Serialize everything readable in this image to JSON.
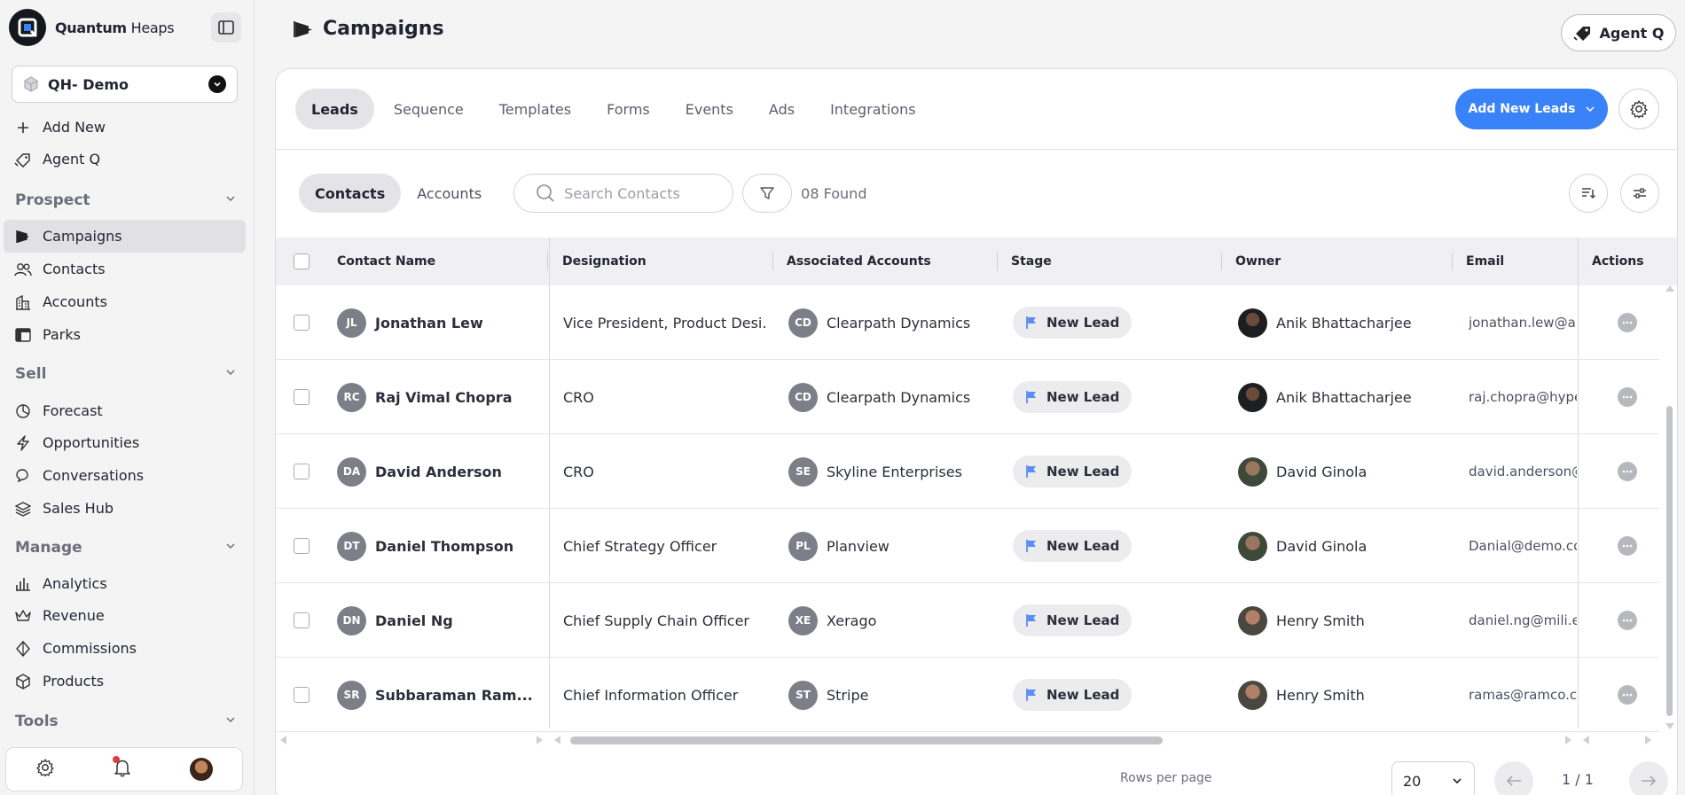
{
  "brand": {
    "name_bold": "Quantum",
    "name_light": " Heaps"
  },
  "workspace": {
    "name": "QH- Demo"
  },
  "sidebar": {
    "top_items": [
      {
        "label": "Add New"
      },
      {
        "label": "Agent Q"
      }
    ],
    "sections": [
      {
        "title": "Prospect",
        "items": [
          "Campaigns",
          "Contacts",
          "Accounts",
          "Parks"
        ]
      },
      {
        "title": "Sell",
        "items": [
          "Forecast",
          "Opportunities",
          "Conversations",
          "Sales Hub"
        ]
      },
      {
        "title": "Manage",
        "items": [
          "Analytics",
          "Revenue",
          "Commissions",
          "Products"
        ]
      },
      {
        "title": "Tools",
        "items": []
      }
    ],
    "active_item": "Campaigns"
  },
  "header": {
    "title": "Campaigns",
    "agent_button": "Agent Q"
  },
  "tabs": [
    "Leads",
    "Sequence",
    "Templates",
    "Forms",
    "Events",
    "Ads",
    "Integrations"
  ],
  "active_tab": "Leads",
  "add_leads_label": "Add New Leads",
  "subtabs": [
    "Contacts",
    "Accounts"
  ],
  "active_subtab": "Contacts",
  "search": {
    "placeholder": "Search Contacts"
  },
  "found_text": "08 Found",
  "table": {
    "columns": [
      "Contact Name",
      "Designation",
      "Associated Accounts",
      "Stage",
      "Owner",
      "Email",
      "Actions"
    ],
    "rows": [
      {
        "initials": "JL",
        "name": "Jonathan Lew",
        "designation": "Vice President, Product Desi...",
        "acc_initials": "CD",
        "account": "Clearpath Dynamics",
        "stage": "New Lead",
        "owner": "Anik Bhattacharjee",
        "email": "jonathan.lew@airv"
      },
      {
        "initials": "RC",
        "name": "Raj Vimal Chopra",
        "designation": "CRO",
        "acc_initials": "CD",
        "account": "Clearpath Dynamics",
        "stage": "New Lead",
        "owner": "Anik Bhattacharjee",
        "email": "raj.chopra@hyper"
      },
      {
        "initials": "DA",
        "name": "David Anderson",
        "designation": "CRO",
        "acc_initials": "SE",
        "account": "Skyline Enterprises",
        "stage": "New Lead",
        "owner": "David Ginola",
        "email": "david.anderson@s"
      },
      {
        "initials": "DT",
        "name": "Daniel Thompson",
        "designation": "Chief Strategy Officer",
        "acc_initials": "PL",
        "account": "Planview",
        "stage": "New Lead",
        "owner": "David Ginola",
        "email": "Danial@demo.con"
      },
      {
        "initials": "DN",
        "name": "Daniel Ng",
        "designation": "Chief Supply Chain Officer",
        "acc_initials": "XE",
        "account": "Xerago",
        "stage": "New Lead",
        "owner": "Henry Smith",
        "email": "daniel.ng@mili.eu"
      },
      {
        "initials": "SR",
        "name": "Subbaraman Ram...",
        "designation": "Chief Information Officer",
        "acc_initials": "ST",
        "account": "Stripe",
        "stage": "New Lead",
        "owner": "Henry Smith",
        "email": "ramas@ramco.co"
      }
    ]
  },
  "pagination": {
    "rows_label": "Rows per page",
    "rows_value": "20",
    "page_text": "1 / 1"
  },
  "colors": {
    "accent": "#3a82f7",
    "stage_flag": "#5b8df5",
    "active_bg": "#e1e1e5"
  }
}
